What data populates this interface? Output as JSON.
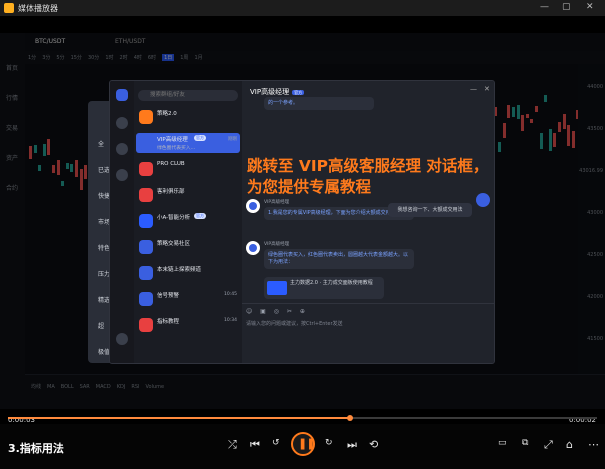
{
  "player": {
    "app_title": "媒体播放器",
    "video_title": "3.指标用法",
    "time_elapsed": "0:00:03",
    "time_remaining": "0:00:02",
    "progress": 0.58,
    "window_controls": [
      "—",
      "▢",
      "✕"
    ]
  },
  "trading": {
    "pair": "BTC/USDT",
    "pair2": "ETH/USDT",
    "timeframes": [
      "1分",
      "3分",
      "5分",
      "15分",
      "30分",
      "1时",
      "2时",
      "4时",
      "6时",
      "1日",
      "1周",
      "1月"
    ],
    "active_timeframe": "1日",
    "sidebar": [
      "首页",
      "行情",
      "交易",
      "资产",
      "合约"
    ],
    "indicators": [
      "均线",
      "MA",
      "BOLL",
      "SAR",
      "MACD",
      "KDJ",
      "RSI",
      "Volume"
    ],
    "price_ticks": [
      "44000",
      "43500",
      "43016.99",
      "43000",
      "42500",
      "42000",
      "41500"
    ],
    "back_dialog_items": [
      "全",
      "已选",
      "快捷",
      "市场",
      "特色",
      "压力",
      "精选",
      "超",
      "极值"
    ]
  },
  "im": {
    "search_placeholder": "搜索群组/好友",
    "conversations": [
      {
        "name": "策略2.0",
        "sub": "",
        "time": "",
        "color": "#ff7a1c"
      },
      {
        "name": "VIP高级经理",
        "sub": "绿色圈代表买入...",
        "time": "刚刚",
        "badge": "官方",
        "color": "#3a5fe0",
        "active": true
      },
      {
        "name": "PRO CLUB",
        "sub": "",
        "time": "",
        "color": "#e84040"
      },
      {
        "name": "客利俱乐部",
        "sub": "",
        "time": "",
        "color": "#e84040"
      },
      {
        "name": "小A-智能分析",
        "sub": "",
        "time": "",
        "badge": "官方",
        "color": "#2b5cff"
      },
      {
        "name": "策略交易社区",
        "sub": "",
        "time": "",
        "color": "#3a5fe0"
      },
      {
        "name": "本末链上探索频道",
        "sub": "",
        "time": "",
        "color": "#3a5fe0"
      },
      {
        "name": "信号预警",
        "sub": "",
        "time": "10:45",
        "color": "#3a5fe0"
      },
      {
        "name": "指标教程",
        "sub": "",
        "time": "10:34",
        "color": "#e84040"
      }
    ],
    "chat": {
      "header": "VIP高级经理",
      "header_tag": "官方",
      "messages": [
        {
          "sender": "",
          "text": "的一个参考。"
        },
        {
          "sender": "VIP高级经理",
          "text": "1.我是您的专属VIP高级经理，下面为您介绍大额成交用法"
        },
        {
          "sender": "VIP高级经理",
          "text": "绿色圈代表买入，红色圈代表卖出，圆圈越大代表金额越大。以下为用法："
        },
        {
          "sender": "",
          "text": "主力数据2.0 · 主力成交面板使用教程"
        }
      ],
      "user_message": "我想咨询一下、大额成交用法",
      "input_placeholder": "请输入您的问题或建议，按Ctrl+Enter发送"
    }
  },
  "annotation": {
    "line1": "跳转至 VIP高级客服经理 对话框，",
    "line2": "为您提供专属教程"
  }
}
